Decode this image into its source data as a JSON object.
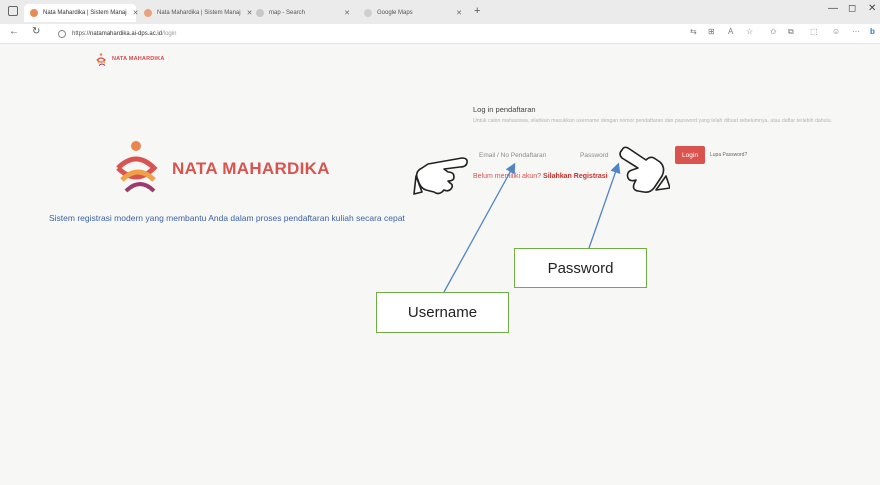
{
  "browser": {
    "tabs": [
      {
        "title": "Nata Mahardika | Sistem Manaj",
        "active": true
      },
      {
        "title": "Nata Mahardika | Sistem Manaj",
        "active": false
      },
      {
        "title": "map - Search",
        "active": false
      },
      {
        "title": "Google Maps",
        "active": false
      }
    ],
    "new_tab": "+",
    "url_host": "natamahardika.ai-dps.ac.id",
    "url_path": "/login",
    "url_scheme": "https://"
  },
  "header": {
    "brand": "NATA MAHARDIKA"
  },
  "hero": {
    "brand": "NATA MAHARDIKA",
    "tagline": "Sistem registrasi modern yang membantu Anda dalam proses pendaftaran kuliah secara cepat"
  },
  "login": {
    "title": "Log in pendaftaran",
    "description": "Untuk calon mahasiswa, silahkan masukkan username dengan nomor pendaftaran dan password yang telah dibuat sebelumnya, atau daftar terlebih dahulu.",
    "username_placeholder": "Email / No Pendaftaran",
    "password_placeholder": "Password",
    "button": "Login",
    "forgot": "Lupa Password?",
    "register_question": "Belum memiliki akun? ",
    "register_link": "Silahkan Registrasi"
  },
  "annotations": {
    "username": "Username",
    "password": "Password"
  },
  "colors": {
    "brand": "#d9534f",
    "tagline": "#3c63a8",
    "annotation_border": "#70ad47",
    "arrow": "#4f86c6"
  }
}
